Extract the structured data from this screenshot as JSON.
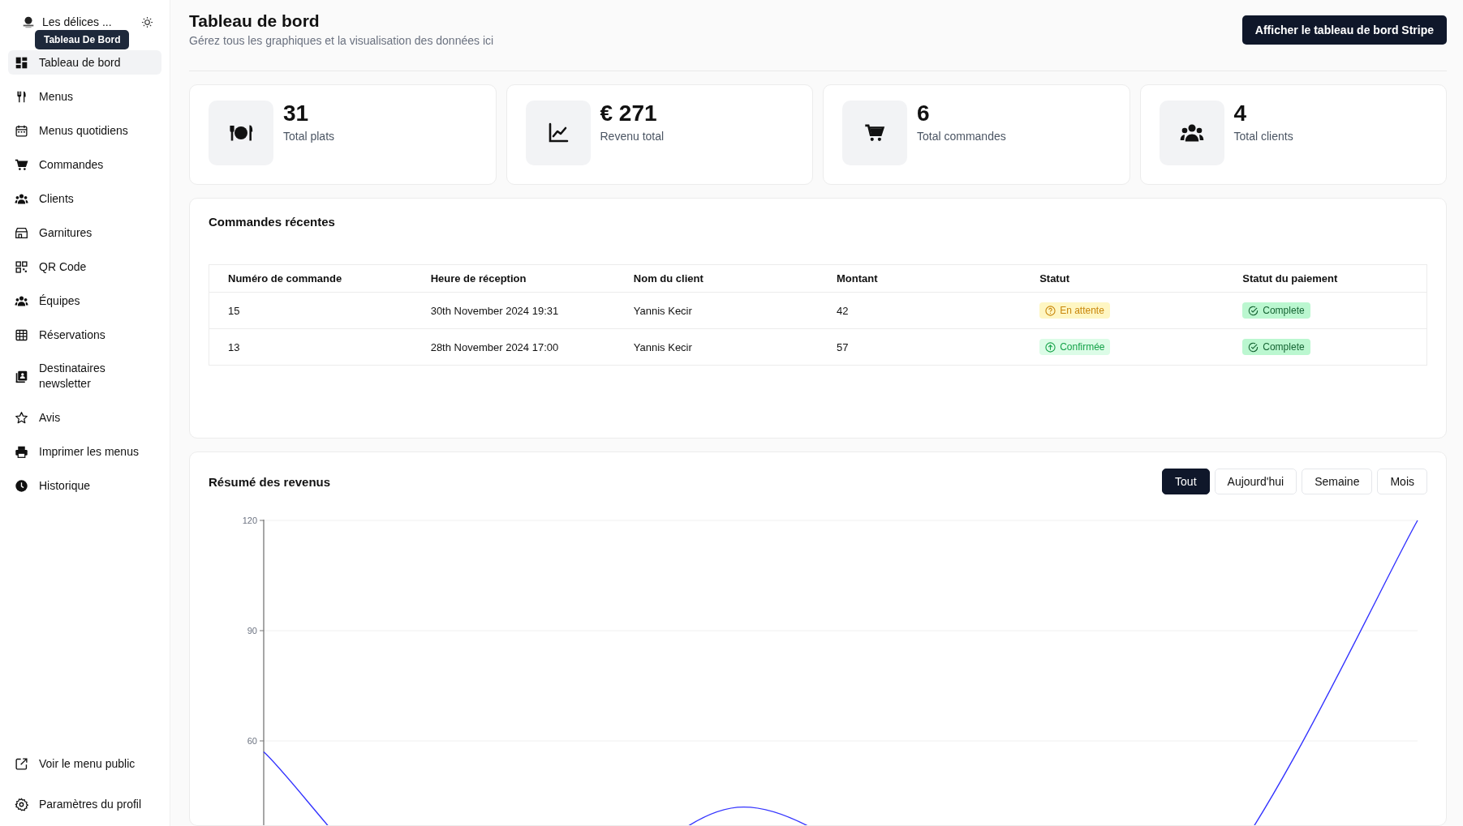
{
  "sidebar": {
    "brand": "Les délices ...",
    "tooltip": "Tableau De Bord",
    "items": [
      {
        "label": "Tableau de bord",
        "selected": true
      },
      {
        "label": "Menus",
        "selected": false
      },
      {
        "label": "Menus quotidiens",
        "selected": false
      },
      {
        "label": "Commandes",
        "selected": false
      },
      {
        "label": "Clients",
        "selected": false
      },
      {
        "label": "Garnitures",
        "selected": false
      },
      {
        "label": "QR Code",
        "selected": false
      },
      {
        "label": "Équipes",
        "selected": false
      },
      {
        "label": "Réservations",
        "selected": false
      },
      {
        "label": "Destinataires newsletter",
        "selected": false
      },
      {
        "label": "Avis",
        "selected": false
      },
      {
        "label": "Imprimer les menus",
        "selected": false
      },
      {
        "label": "Historique",
        "selected": false
      }
    ],
    "footer_items": [
      {
        "label": "Voir le menu public"
      },
      {
        "label": "Paramètres du profil"
      }
    ]
  },
  "header": {
    "title": "Tableau de bord",
    "subtitle": "Gérez tous les graphiques et la visualisation des données ici",
    "button": "Afficher le tableau de bord Stripe"
  },
  "stats": [
    {
      "value": "31",
      "label": "Total plats"
    },
    {
      "value": "€ 271",
      "label": "Revenu total"
    },
    {
      "value": "6",
      "label": "Total commandes"
    },
    {
      "value": "4",
      "label": "Total clients"
    }
  ],
  "recent_orders": {
    "title": "Commandes récentes",
    "columns": [
      "Numéro de commande",
      "Heure de réception",
      "Nom du client",
      "Montant",
      "Statut",
      "Statut du paiement"
    ],
    "rows": [
      {
        "number": "15",
        "time": "30th November 2024 19:31",
        "client": "Yannis Kecir",
        "amount": "42",
        "status": {
          "kind": "pending",
          "label": "En attente"
        },
        "payment": {
          "kind": "complete",
          "label": "Complete"
        }
      },
      {
        "number": "13",
        "time": "28th November 2024 17:00",
        "client": "Yannis Kecir",
        "amount": "57",
        "status": {
          "kind": "confirmed",
          "label": "Confirmée"
        },
        "payment": {
          "kind": "complete",
          "label": "Complete"
        }
      }
    ]
  },
  "revenue": {
    "title": "Résumé des revenus",
    "filters": [
      {
        "label": "Tout",
        "selected": true
      },
      {
        "label": "Aujourd'hui",
        "selected": false
      },
      {
        "label": "Semaine",
        "selected": false
      },
      {
        "label": "Mois",
        "selected": false
      }
    ],
    "y_axis_labels": [
      "120",
      "90",
      "60"
    ]
  }
}
